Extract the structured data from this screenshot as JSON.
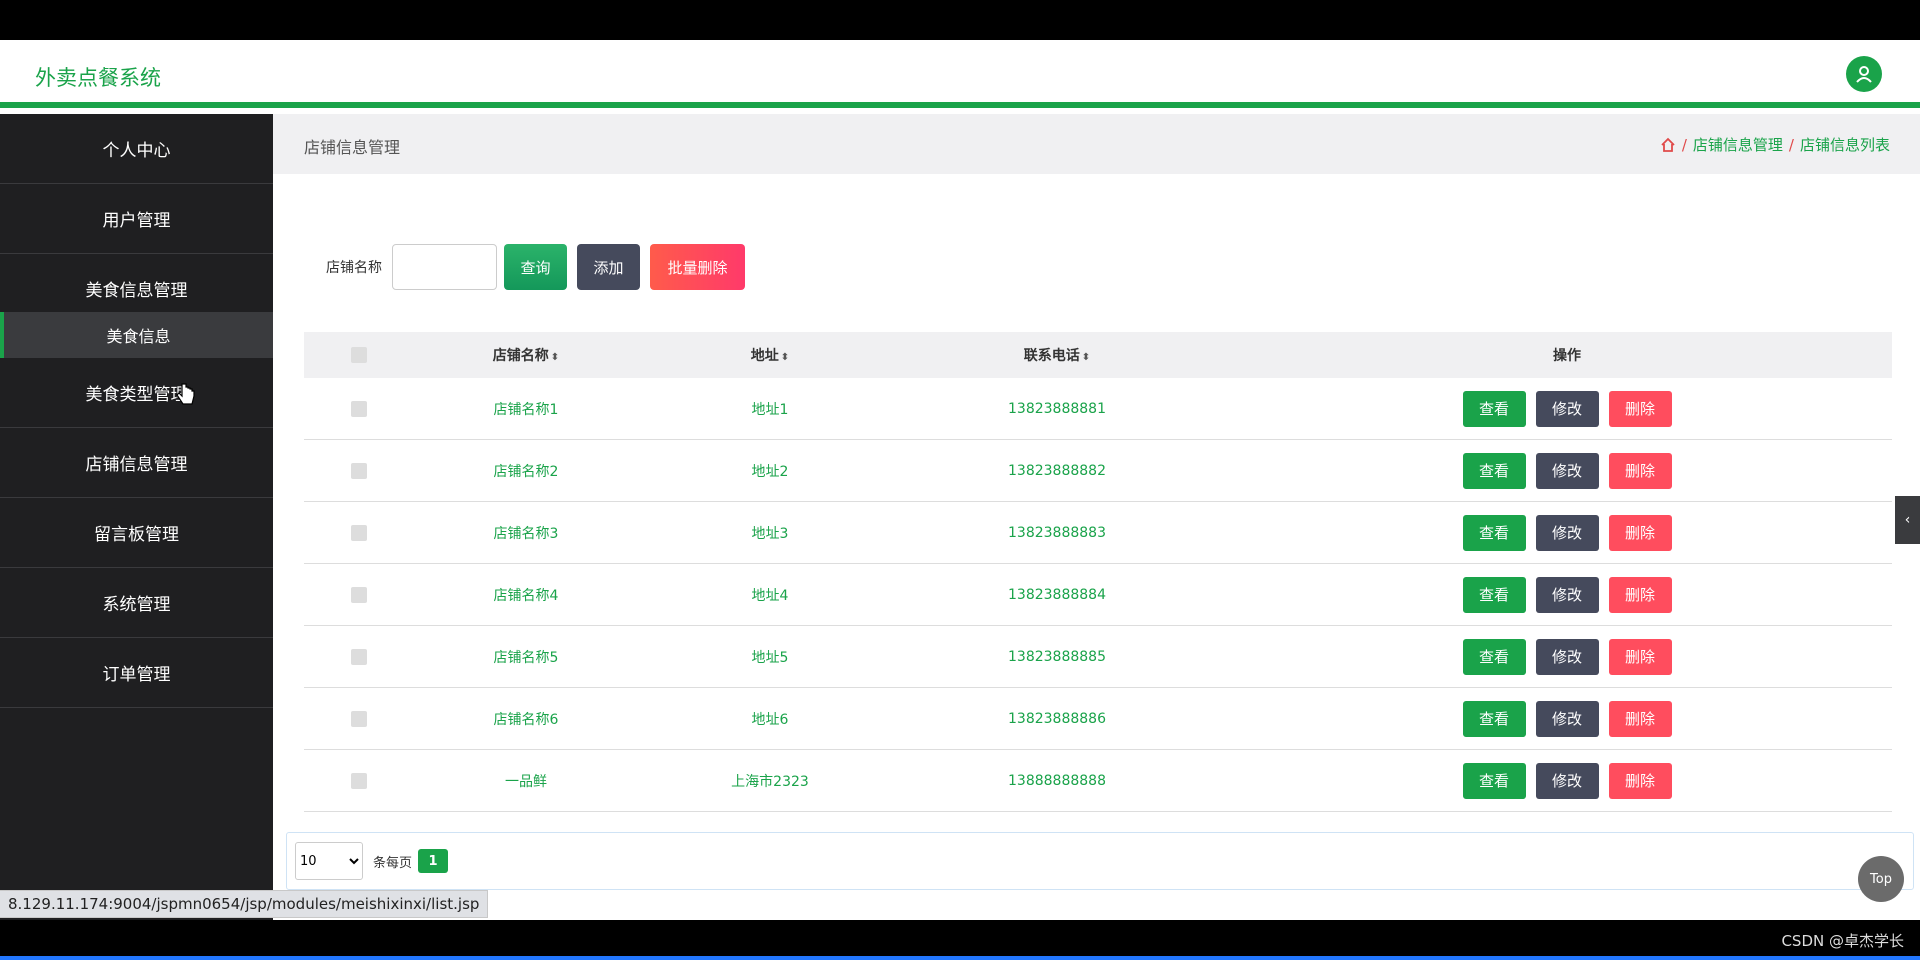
{
  "app": {
    "title": "外卖点餐系统"
  },
  "sidebar": {
    "items": [
      {
        "label": "个人中心"
      },
      {
        "label": "用户管理"
      },
      {
        "label": "美食信息管理"
      },
      {
        "label": "美食类型管理"
      },
      {
        "label": "店铺信息管理"
      },
      {
        "label": "留言板管理"
      },
      {
        "label": "系统管理"
      },
      {
        "label": "订单管理"
      }
    ],
    "active_sub": "美食信息"
  },
  "breadcrumb": {
    "page_title": "店铺信息管理",
    "path": [
      "店铺信息管理",
      "店铺信息列表"
    ],
    "separator": "/"
  },
  "search": {
    "label": "店铺名称",
    "value": "",
    "query_label": "查询",
    "add_label": "添加",
    "batch_delete_label": "批量删除"
  },
  "table": {
    "columns": [
      "店铺名称",
      "地址",
      "联系电话",
      "操作"
    ],
    "rows": [
      {
        "name": "店铺名称1",
        "address": "地址1",
        "phone": "13823888881"
      },
      {
        "name": "店铺名称2",
        "address": "地址2",
        "phone": "13823888882"
      },
      {
        "name": "店铺名称3",
        "address": "地址3",
        "phone": "13823888883"
      },
      {
        "name": "店铺名称4",
        "address": "地址4",
        "phone": "13823888884"
      },
      {
        "name": "店铺名称5",
        "address": "地址5",
        "phone": "13823888885"
      },
      {
        "name": "店铺名称6",
        "address": "地址6",
        "phone": "13823888886"
      },
      {
        "name": "一品鲜",
        "address": "上海市2323",
        "phone": "13888888888"
      }
    ],
    "actions": {
      "view": "查看",
      "edit": "修改",
      "delete": "删除"
    }
  },
  "pager": {
    "page_size": "10",
    "page_size_label": "条每页",
    "current_page": "1"
  },
  "floating": {
    "top_label": "Top",
    "handle": "‹"
  },
  "status_bar": {
    "url": "8.129.11.174:9004/jspmn0654/jsp/modules/meishixinxi/list.jsp"
  },
  "watermark": "CSDN @卓杰学长",
  "colors": {
    "accent": "#1aa34a",
    "danger": "#ff4d5e",
    "dark": "#454a5c",
    "sidebar": "#1f1f21"
  }
}
